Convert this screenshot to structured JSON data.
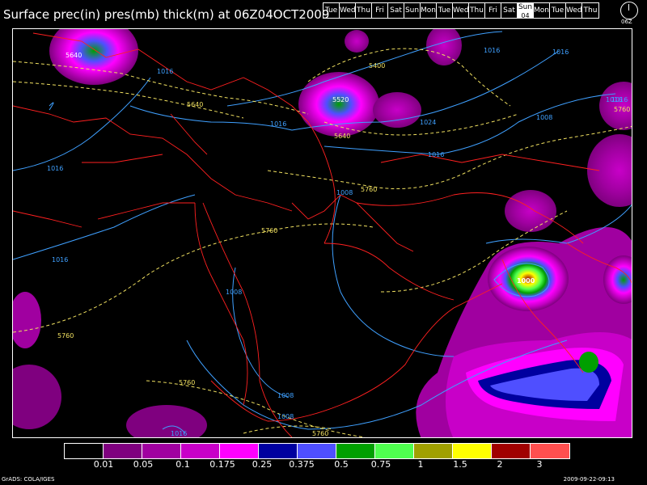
{
  "title": "Surface prec(in) pres(mb) thick(m) at 06Z04OCT2009",
  "day_strip": [
    "Tue",
    "Wed",
    "Thu",
    "Fri",
    "Sat",
    "Sun",
    "Mon",
    "Tue",
    "Wed",
    "Thu",
    "Fri",
    "Sat",
    "Sun",
    "Mon",
    "Tue",
    "Wed",
    "Thu"
  ],
  "selected_day_index": 12,
  "selected_day_sub": "04",
  "clock_label": "06Z",
  "legend": {
    "colors": [
      "#000000",
      "#7f007f",
      "#a000a0",
      "#c800c8",
      "#ff00ff",
      "#00009f",
      "#4f4fff",
      "#009f00",
      "#4fff4f",
      "#a0a000",
      "#ffff00",
      "#a00000",
      "#ff4f4f"
    ],
    "ticks": [
      "0.01",
      "0.05",
      "0.1",
      "0.175",
      "0.25",
      "0.375",
      "0.5",
      "0.75",
      "1",
      "1.5",
      "2",
      "3"
    ]
  },
  "contour_labels": {
    "pressure": [
      "1016",
      "1016",
      "1016",
      "1016",
      "1016",
      "1008",
      "1016",
      "1024",
      "1016",
      "1016",
      "1008",
      "1008",
      "1008",
      "1000",
      "1016",
      "1016",
      "1008"
    ],
    "thickness": [
      "5640",
      "5640",
      "5400",
      "5520",
      "5640",
      "5760",
      "5760",
      "5760",
      "5760",
      "5760",
      "5760"
    ]
  },
  "footer_left": "GrADS: COLA/IGES",
  "footer_right": "2009-09-22-09:13"
}
